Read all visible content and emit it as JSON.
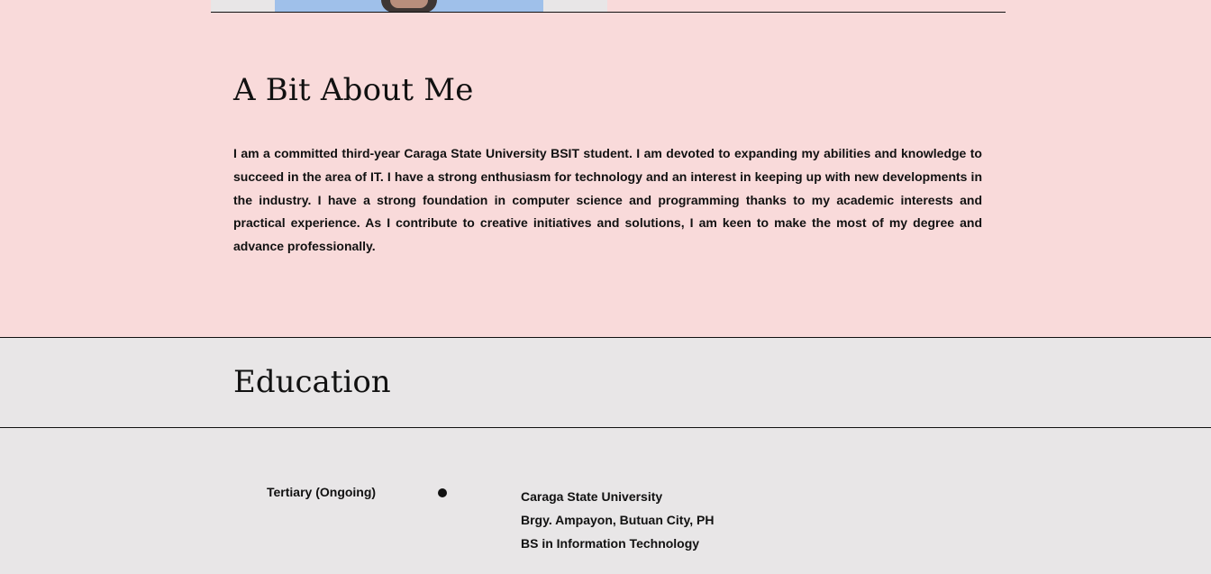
{
  "about": {
    "title": "A Bit About Me",
    "text": "I am a committed third-year Caraga State University BSIT student. I am devoted to expanding my abilities and knowledge to succeed in the area of IT. I have a strong enthusiasm for technology and an interest in keeping up with new developments in the industry. I have a strong foundation in computer science and programming thanks to my academic interests and practical experience. As I contribute to creative initiatives and solutions, I am keen to make the most of my degree and advance professionally."
  },
  "education": {
    "title": "Education",
    "entries": [
      {
        "level": "Tertiary (Ongoing)",
        "school": "Caraga State University",
        "address": "Brgy. Ampayon, Butuan City, PH",
        "program": "BS in Information Technology"
      }
    ]
  },
  "colors": {
    "about_background": "#f9dada",
    "page_background": "#e8e6e7",
    "text": "#111111",
    "photo_background": "#9fc0ea"
  }
}
